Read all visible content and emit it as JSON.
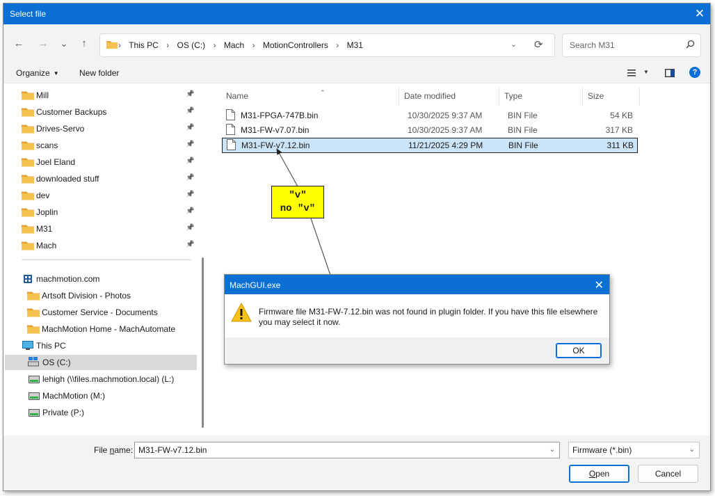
{
  "dialog": {
    "title": "Select file",
    "close_glyph": "✕"
  },
  "address": {
    "crumbs": [
      "This PC",
      "OS (C:)",
      "Mach",
      "MotionControllers",
      "M31"
    ],
    "dropdown_glyph": "⌄",
    "refresh_glyph": "⟳"
  },
  "search": {
    "placeholder": "Search M31"
  },
  "nav_buttons": {
    "back": "←",
    "forward": "→",
    "recent": "⌄",
    "up": "↑"
  },
  "commandbar": {
    "organize": "Organize",
    "new_folder": "New folder",
    "help": "?"
  },
  "sidebar": {
    "quick": [
      "Mill",
      "Customer Backups",
      "Drives-Servo",
      "scans",
      "Joel Eland",
      "downloaded stuff",
      "dev",
      "Joplin",
      "M31",
      "Mach"
    ],
    "pin_glyph": "📌",
    "cloud_root": "machmotion.com",
    "cloud_items": [
      "Artsoft Division - Photos",
      "Customer Service - Documents",
      "MachMotion Home - MachAutomate"
    ],
    "pc_root": "This PC",
    "drives": [
      "OS (C:)",
      "lehigh (\\\\files.machmotion.local) (L:)",
      "MachMotion (M:)",
      "Private (P:)"
    ]
  },
  "columns": {
    "name": "Name",
    "date": "Date modified",
    "type": "Type",
    "size": "Size"
  },
  "files": [
    {
      "name": "M31-FPGA-747B.bin",
      "date": "10/30/2025 9:37 AM",
      "type": "BIN File",
      "size": "54 KB"
    },
    {
      "name": "M31-FW-v7.07.bin",
      "date": "10/30/2025 9:37 AM",
      "type": "BIN File",
      "size": "317 KB"
    },
    {
      "name": "M31-FW-v7.12.bin",
      "date": "11/21/2025 4:29 PM",
      "type": "BIN File",
      "size": "311 KB"
    }
  ],
  "bottom": {
    "file_name_label_pre": "File ",
    "file_name_label_accel": "n",
    "file_name_label_post": "ame:",
    "file_name_value": "M31-FW-v7.12.bin",
    "filter_value": "Firmware (*.bin)",
    "open_accel": "O",
    "open_rest": "pen",
    "cancel": "Cancel"
  },
  "callout": {
    "line1": "\"v\"",
    "line2": "no \"v\""
  },
  "messagebox": {
    "title": "MachGUI.exe",
    "close_glyph": "✕",
    "message": "Firmware file M31-FW-7.12.bin was not found in plugin folder. If you have this file elsewhere you may select it now.",
    "ok": "OK"
  },
  "colors": {
    "accent": "#0b6fd4",
    "selection": "#cce4f7",
    "folder": "#f2c14e",
    "callout": "#ffff00"
  }
}
